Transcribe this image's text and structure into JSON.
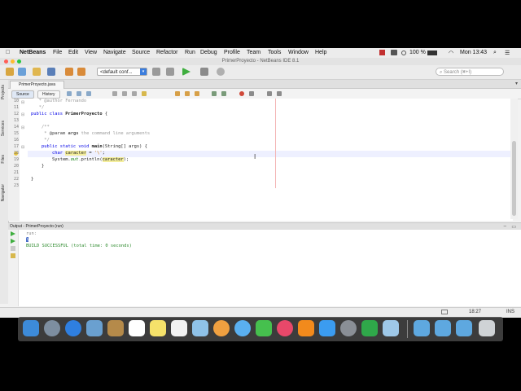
{
  "menubar": {
    "apple": "",
    "app": "NetBeans",
    "items": [
      "File",
      "Edit",
      "View",
      "Navigate",
      "Source",
      "Refactor",
      "Run",
      "Debug",
      "Profile",
      "Team",
      "Tools",
      "Window",
      "Help"
    ],
    "battery": "100 %",
    "clock": "Mon 13:43"
  },
  "window": {
    "title": "PrimerProyecto - NetBeans IDE 8.1"
  },
  "toolbar": {
    "config": "<default conf...",
    "search_placeholder": "Search (⌘+I)"
  },
  "side_tabs": [
    "Projects",
    "Services",
    "Files",
    "Navigator"
  ],
  "file_tab": "PrimerProyecto.java",
  "editor_tabs": {
    "source": "Source",
    "history": "History"
  },
  "editor": {
    "lines": [
      {
        "n": "10",
        "text": "   * @author Fernando"
      },
      {
        "n": "11",
        "text": "   */"
      },
      {
        "n": "12",
        "text": "public class PrimerProyecto {"
      },
      {
        "n": "13",
        "text": ""
      },
      {
        "n": "14",
        "text": "    /**"
      },
      {
        "n": "15",
        "text": "     * @param args the command line arguments"
      },
      {
        "n": "16",
        "text": "     */"
      },
      {
        "n": "17",
        "text": "    public static void main(String[] args) {"
      },
      {
        "n": "18",
        "text": "        char caracter = '\\';"
      },
      {
        "n": "19",
        "text": "        System.out.println(caracter);"
      },
      {
        "n": "20",
        "text": "    }"
      },
      {
        "n": "21",
        "text": ""
      },
      {
        "n": "22",
        "text": "}"
      },
      {
        "n": "23",
        "text": ""
      }
    ]
  },
  "output": {
    "tab": "Output - PrimerProyecto (run)",
    "lines": [
      "run:",
      "\\",
      "BUILD SUCCESSFUL (total time: 0 seconds)"
    ]
  },
  "status": {
    "position": "18:27",
    "mode": "INS"
  },
  "colors": {
    "keyword": "#0000e6",
    "comment": "#9a9a9a",
    "highlight": "#f4ee9c",
    "success": "#2e8b2e"
  }
}
